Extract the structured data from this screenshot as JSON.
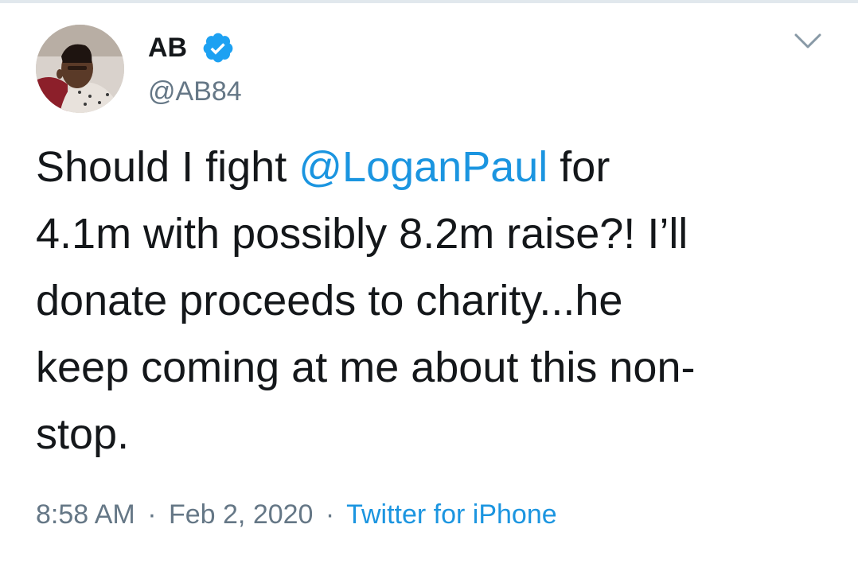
{
  "tweet": {
    "author": {
      "display_name": "AB",
      "handle": "@AB84",
      "verified_icon": "verified-badge-icon",
      "avatar": "profile-photo"
    },
    "menu_icon": "chevron-down-icon",
    "text_lines": {
      "line1_before": "Should I fight ",
      "line1_mention": "@LoganPaul",
      "line1_after": " for",
      "line2": "4.1m with possibly 8.2m raise?! I’ll",
      "line3": "donate proceeds to charity...he",
      "line4": "keep coming at me about this non-",
      "line5": "stop."
    },
    "time": "8:58 AM",
    "separator": "·",
    "date": "Feb 2, 2020",
    "source": "Twitter for iPhone"
  },
  "colors": {
    "text": "#14171a",
    "secondary": "#657786",
    "link": "#1b95e0",
    "verified": "#1da1f2"
  }
}
